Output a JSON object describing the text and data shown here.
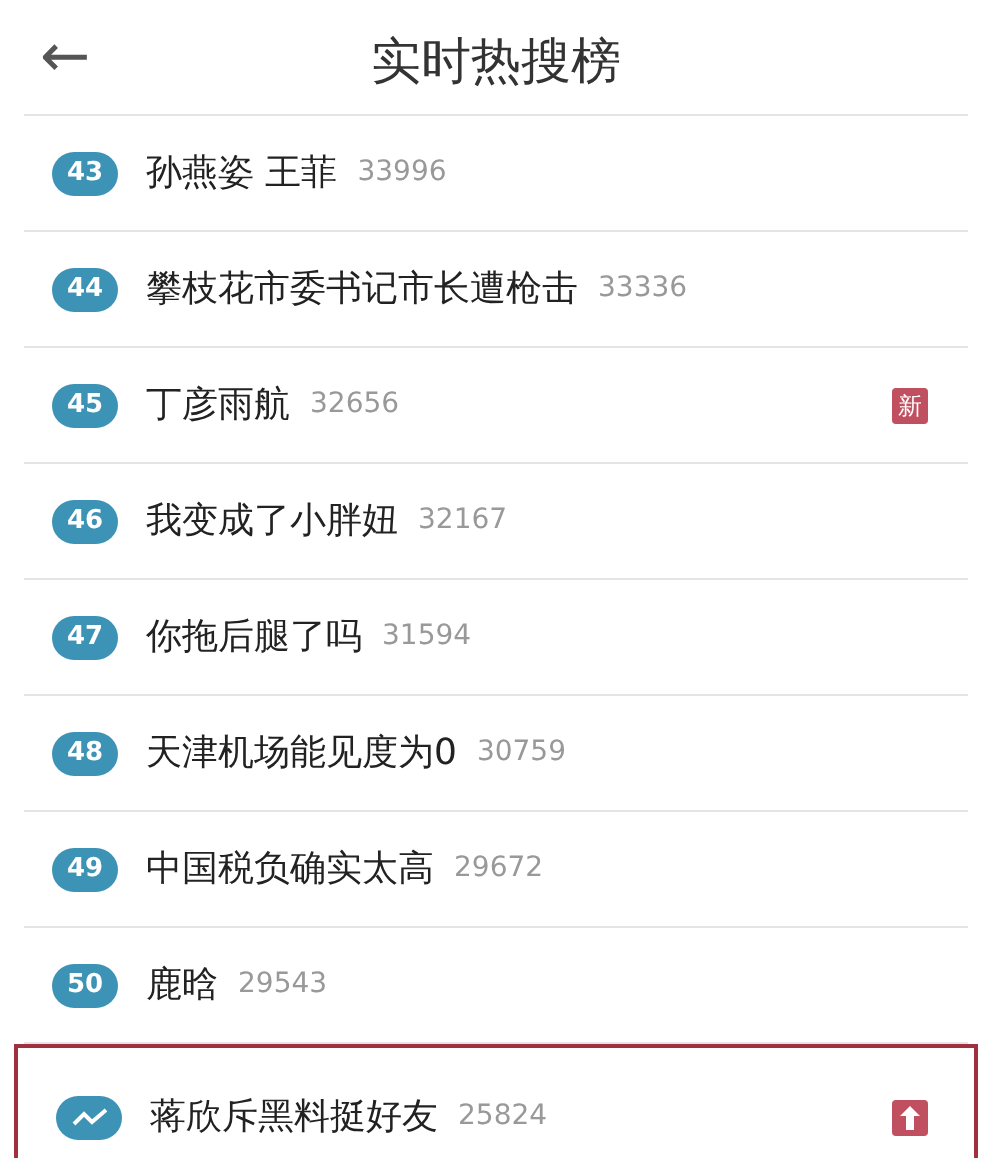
{
  "header": {
    "back": "←",
    "title": "实时热搜榜"
  },
  "items": [
    {
      "kind": "rank",
      "rank": "43",
      "text": "孙燕姿 王菲",
      "count": "33996",
      "highlighted": false
    },
    {
      "kind": "rank",
      "rank": "44",
      "text": "攀枝花市委书记市长遭枪击",
      "count": "33336",
      "highlighted": false
    },
    {
      "kind": "rank",
      "rank": "45",
      "text": "丁彦雨航",
      "count": "32656",
      "tag": {
        "kind": "new",
        "text": "新"
      },
      "highlighted": false
    },
    {
      "kind": "rank",
      "rank": "46",
      "text": "我变成了小胖妞",
      "count": "32167",
      "highlighted": false
    },
    {
      "kind": "rank",
      "rank": "47",
      "text": "你拖后腿了吗",
      "count": "31594",
      "highlighted": false
    },
    {
      "kind": "rank",
      "rank": "48",
      "text": "天津机场能见度为0",
      "count": "30759",
      "highlighted": false
    },
    {
      "kind": "rank",
      "rank": "49",
      "text": "中国税负确实太高",
      "count": "29672",
      "highlighted": false
    },
    {
      "kind": "rank",
      "rank": "50",
      "text": "鹿晗",
      "count": "29543",
      "highlighted": false
    },
    {
      "kind": "trend",
      "text": "蒋欣斥黑料挺好友",
      "count": "25824",
      "tag": {
        "kind": "rising"
      },
      "highlighted": true
    }
  ]
}
